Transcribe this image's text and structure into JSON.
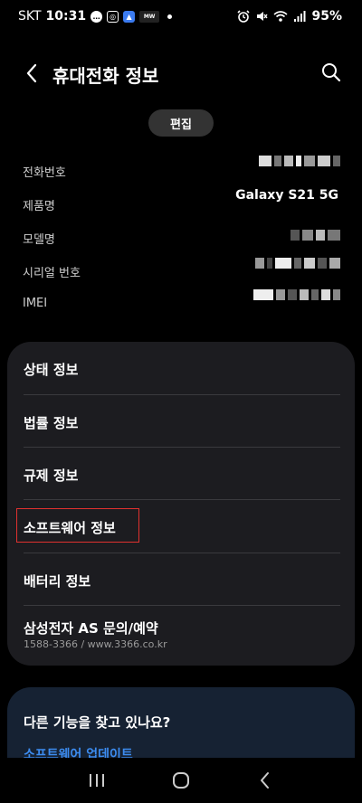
{
  "status_bar": {
    "carrier": "SKT",
    "time": "10:31",
    "battery": "95%",
    "icons": [
      "chat-icon",
      "instagram-icon",
      "app-icon",
      "mw-icon",
      "alarm-icon",
      "mute-icon",
      "wifi-icon",
      "signal-icon"
    ],
    "mw_label": "MW"
  },
  "header": {
    "title": "휴대전화 정보",
    "edit_label": "편집"
  },
  "info": {
    "phone_label": "전화번호",
    "model_name_label": "제품명",
    "model_name_value": "Galaxy S21 5G",
    "model_number_label": "모델명",
    "serial_label": "시리얼 번호",
    "imei_label": "IMEI"
  },
  "menu": {
    "items": [
      {
        "label": "상태 정보"
      },
      {
        "label": "법률 정보"
      },
      {
        "label": "규제 정보"
      },
      {
        "label": "소프트웨어 정보"
      },
      {
        "label": "배터리 정보"
      },
      {
        "label": "삼성전자 AS 문의/예약",
        "sub": "1588-3366 / www.3366.co.kr"
      }
    ]
  },
  "suggest": {
    "title": "다른 기능을 찾고 있나요?",
    "link": "소프트웨어 업데이트"
  },
  "colors": {
    "background": "#000000",
    "card": "#1c1c20",
    "highlight": "#e0312f",
    "link": "#3c8cf0",
    "suggest_card": "#162233"
  }
}
